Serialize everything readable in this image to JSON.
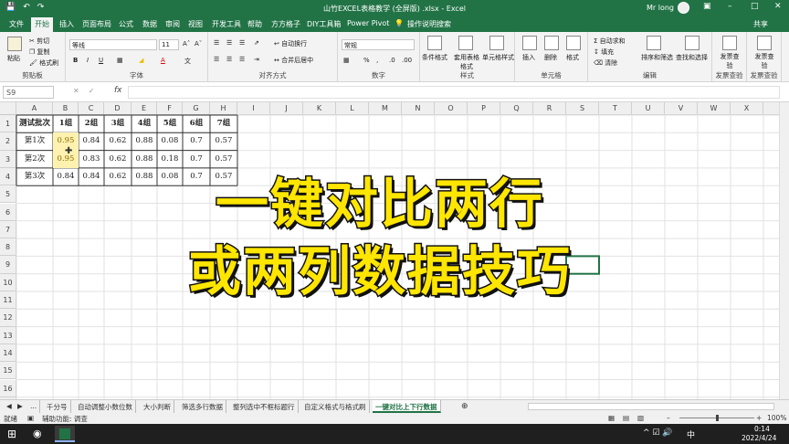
{
  "titlebar": {
    "title": "山竹EXCEL表格教学 (全屏版) .xlsx - Excel",
    "user": "Mr long"
  },
  "tabs": [
    "文件",
    "开始",
    "插入",
    "页面布局",
    "公式",
    "数据",
    "审阅",
    "视图",
    "帮助",
    "方方格子",
    "DIY工具箱",
    "Power Pivot",
    "操作说明搜索"
  ],
  "share": "共享",
  "ribbon": {
    "clipboard": {
      "paste": "粘贴",
      "cut": "剪切",
      "copy": "复制",
      "format_painter": "格式刷",
      "label": "剪贴板"
    },
    "font": {
      "name": "等线",
      "size": "11",
      "label": "字体"
    },
    "align": {
      "wrap": "自动换行",
      "merge": "合并后居中",
      "label": "对齐方式"
    },
    "number": {
      "format": "常规",
      "label": "数字"
    },
    "styles": {
      "cond": "条件格式",
      "table": "套用表格格式",
      "cell": "单元格样式",
      "label": "样式"
    },
    "cells": {
      "insert": "插入",
      "delete": "删除",
      "format": "格式",
      "label": "单元格"
    },
    "editing": {
      "autosum": "自动求和",
      "fill": "填充",
      "clear": "清除",
      "sort": "排序和筛选",
      "find": "查找和选择",
      "label": "编辑"
    },
    "invoice1": {
      "btn": "发票查验",
      "label": "发票查验"
    },
    "invoice2": {
      "btn": "发票查验",
      "label": "发票查验"
    }
  },
  "formula": {
    "namebox": "S9",
    "fx": "fx"
  },
  "columns": [
    "A",
    "B",
    "C",
    "D",
    "E",
    "F",
    "G",
    "H",
    "I",
    "J",
    "K",
    "L",
    "M",
    "N",
    "O",
    "P",
    "Q",
    "R",
    "S",
    "T",
    "U",
    "V",
    "W",
    "X"
  ],
  "rows": [
    "1",
    "2",
    "3",
    "4",
    "5",
    "6",
    "7",
    "8",
    "9",
    "10",
    "11",
    "12",
    "13",
    "14",
    "15",
    "16",
    "17"
  ],
  "table": {
    "header": [
      "测试批次",
      "1组",
      "2组",
      "3组",
      "4组",
      "5组",
      "6组",
      "7组"
    ],
    "rows": [
      [
        "第1次",
        "0.95",
        "0.84",
        "0.62",
        "0.88",
        "0.08",
        "0.7",
        "0.57"
      ],
      [
        "第2次",
        "0.95",
        "0.83",
        "0.62",
        "0.88",
        "0.18",
        "0.7",
        "0.57"
      ],
      [
        "第3次",
        "0.84",
        "0.84",
        "0.62",
        "0.88",
        "0.08",
        "0.7",
        "0.57"
      ]
    ]
  },
  "overlay": {
    "line1": "一键对比两行",
    "line2": "或两列数据技巧"
  },
  "sheets": [
    "...",
    "千分号",
    "自动调整小数位数",
    "大小判断",
    "筛选多行数据",
    "整列选中不框标题行",
    "自定义格式与格式刷",
    "一键对比上下行数据"
  ],
  "status": {
    "mode": "就绪",
    "accessibility": "辅助功能: 调查",
    "zoom": "100%"
  },
  "taskbar": {
    "time": "0:14",
    "date": "2022/4/24"
  },
  "colors": {
    "accent": "#217346",
    "highlight": "#fff2b0",
    "overlay_text": "#ffe600"
  }
}
